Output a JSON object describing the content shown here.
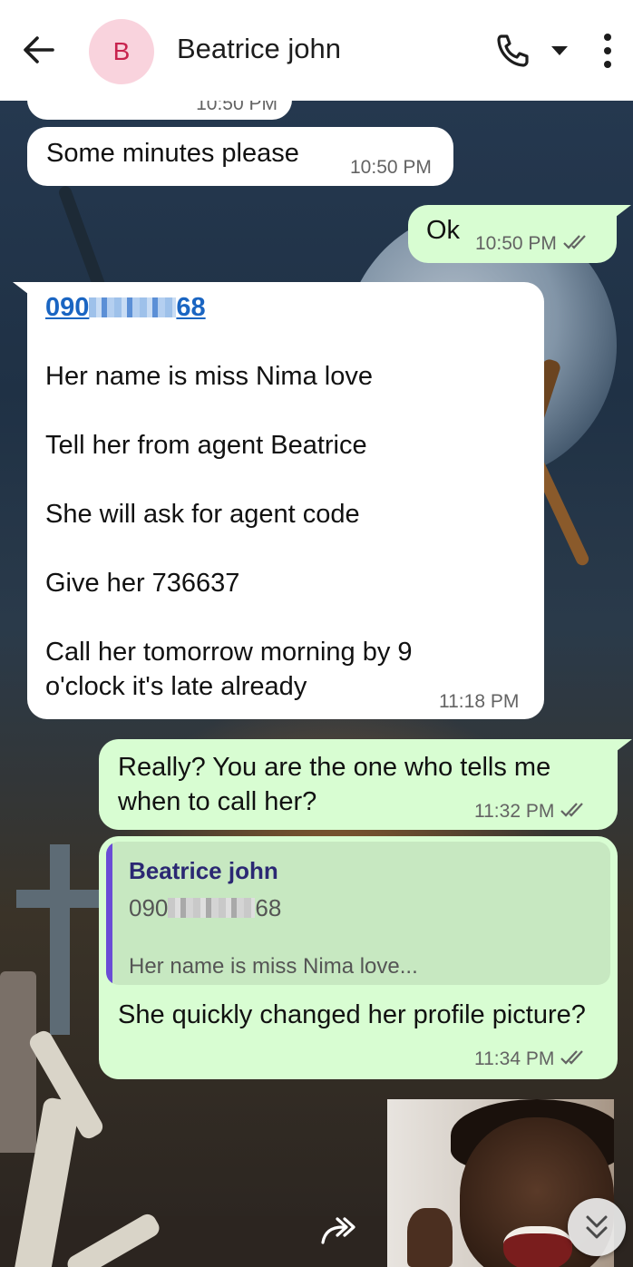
{
  "header": {
    "avatar_letter": "B",
    "contact_name": "Beatrice john"
  },
  "messages": {
    "top_partial_time": "10:50 PM",
    "some_minutes": {
      "text": "Some minutes please",
      "time": "10:50 PM"
    },
    "ok": {
      "text": "Ok",
      "time": "10:50 PM"
    },
    "long": {
      "phone_prefix": "090",
      "phone_suffix": "68",
      "line1": "Her name is miss Nima love",
      "line2": "Tell her from agent Beatrice",
      "line3": "She will ask for agent code",
      "line4": "Give her 736637",
      "line5a": "Call her tomorrow morning by 9",
      "line5b": "o'clock it's late already",
      "time": "11:18 PM"
    },
    "really": {
      "text": "Really? You are the one who tells me when to call her?",
      "time": "11:32 PM"
    },
    "reply": {
      "quote_name": "Beatrice john",
      "quote_phone_prefix": "090",
      "quote_phone_suffix": "68",
      "quote_text": "Her name is miss Nima love...",
      "text": "She quickly changed her profile picture?",
      "time": "11:34 PM"
    }
  },
  "colors": {
    "header_bg": "#ffffff",
    "incoming_bubble": "#ffffff",
    "outgoing_bubble": "#d8fdd2",
    "link": "#1a65c2",
    "quote_bar": "#6a4cd6",
    "avatar_bg": "#f9d3dd",
    "avatar_fg": "#c8234e"
  }
}
